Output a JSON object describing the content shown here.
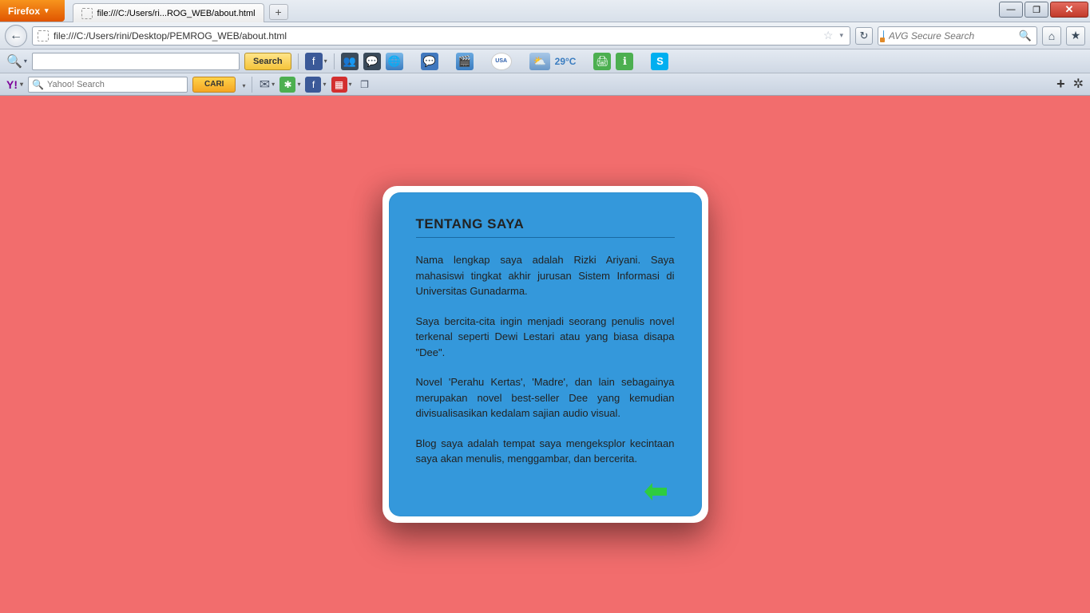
{
  "titlebar": {
    "firefox": "Firefox",
    "tab_title": "file:///C:/Users/ri...ROG_WEB/about.html",
    "newtab": "+"
  },
  "window": {
    "min": "—",
    "max": "❐",
    "close": "✕"
  },
  "nav": {
    "url": "file:///C:/Users/rini/Desktop/PEMROG_WEB/about.html",
    "search_placeholder": "AVG Secure Search"
  },
  "toolbar1": {
    "search_label": "Search",
    "temp": "29°C"
  },
  "toolbar2": {
    "yahoo": "Y!",
    "yahoo_search_placeholder": "Yahoo! Search",
    "cari": "CARI",
    "skype": "S",
    "usa": "USA"
  },
  "content": {
    "heading": "TENTANG SAYA",
    "p1": "Nama lengkap saya adalah Rizki Ariyani. Saya mahasiswi tingkat akhir jurusan Sistem Informasi di Universitas Gunadarma.",
    "p2": "Saya bercita-cita ingin menjadi seorang penulis novel terkenal seperti Dewi Lestari atau yang biasa disapa \"Dee\".",
    "p3": "Novel 'Perahu Kertas', 'Madre', dan lain sebagainya merupakan novel best-seller Dee yang kemudian divisualisasikan kedalam sajian audio visual.",
    "p4": "Blog saya adalah tempat saya mengeksplor kecintaan saya akan menulis, menggambar, dan bercerita."
  }
}
